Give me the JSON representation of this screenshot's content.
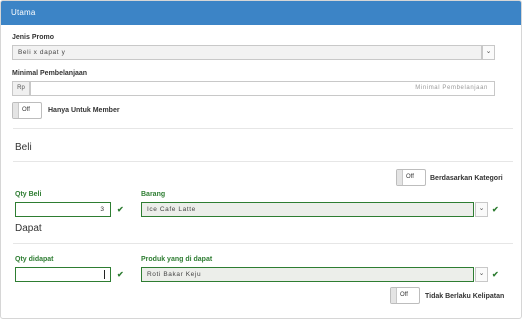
{
  "header": {
    "title": "Utama"
  },
  "promo": {
    "jenis_label": "Jenis Promo",
    "jenis_value": "Beli x dapat y",
    "minimal_label": "Minimal Pembelanjaan",
    "currency_prefix": "Rp",
    "minimal_placeholder": "Minimal Pembelanjaan",
    "member_toggle_state": "Off",
    "member_toggle_label": "Hanya Untuk Member"
  },
  "beli": {
    "section_title": "Beli",
    "kategori_toggle_state": "Off",
    "kategori_label": "Berdasarkan Kategori",
    "qty_label": "Qty Beli",
    "qty_value": "3",
    "barang_label": "Barang",
    "barang_value": "Ice Cafe Latte"
  },
  "dapat": {
    "section_title": "Dapat",
    "qty_label": "Qty didapat",
    "qty_value": "",
    "produk_label": "Produk yang di dapat",
    "produk_value": "Roti Bakar Keju",
    "kelipatan_toggle_state": "Off",
    "kelipatan_label": "Tidak Berlaku Kelipatan"
  },
  "icons": {
    "check": "✔",
    "caret": "⌄"
  },
  "colors": {
    "header": "#3c84c6",
    "valid": "#2e7d32"
  }
}
